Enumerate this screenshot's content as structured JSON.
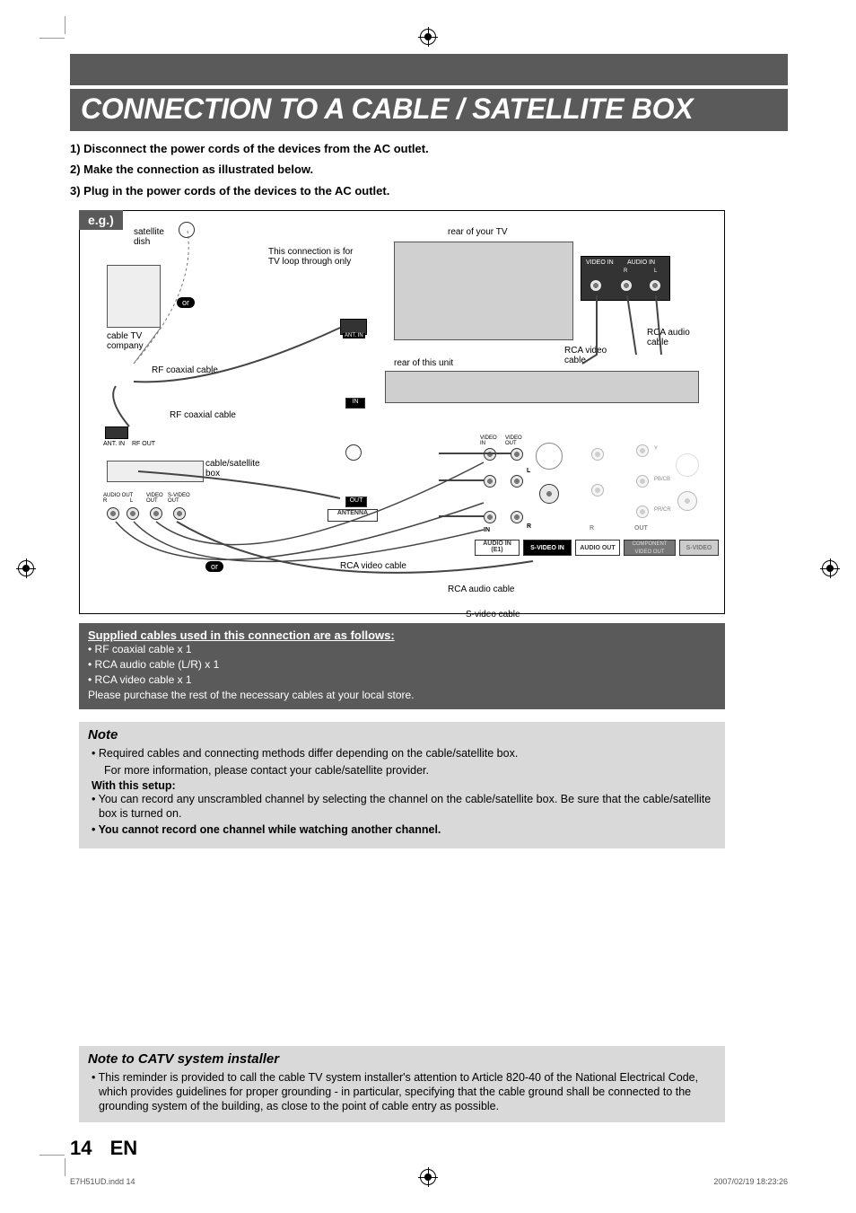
{
  "title": "CONNECTION TO A CABLE / SATELLITE BOX",
  "steps": {
    "s1": "1) Disconnect the power cords of the devices from the AC outlet.",
    "s2": "2) Make the connection as illustrated below.",
    "s3": "3) Plug in the power cords of the devices to the AC outlet."
  },
  "diagram": {
    "eg": "e.g.)",
    "satellite_dish": "satellite\ndish",
    "cable_tv_company": "cable TV\ncompany",
    "rf_coaxial_cable": "RF coaxial cable",
    "rf_coaxial_cable2": "RF coaxial cable",
    "cable_satellite_box": "cable/satellite\nbox",
    "or_upper": "or",
    "or_lower": "or",
    "loop_through": "This connection is for\nTV loop through only",
    "rear_tv": "rear of your TV",
    "rear_unit": "rear of this unit",
    "rca_video_cable": "RCA video\ncable",
    "rca_audio_cable": "RCA audio\ncable",
    "rca_video_cable2": "RCA video cable",
    "rca_audio_cable2": "RCA audio cable",
    "svideo_cable": "S-video cable",
    "ant_in": "ANT. IN",
    "ant_in_small": "ANT. IN",
    "rf_out": "RF OUT",
    "audio_out_r": "AUDIO OUT\nR",
    "audio_out_l": "L",
    "video_out_small": "VIDEO\nOUT",
    "svideo_out_small": "S-VIDEO\nOUT",
    "in_label": "IN",
    "out_label": "OUT",
    "antenna_label": "ANTENNA",
    "video_in_tv": "VIDEO IN",
    "audio_in_tv": "AUDIO IN",
    "r_label": "R",
    "l_label": "L",
    "video_in": "VIDEO\nIN",
    "video_out": "VIDEO\nOUT",
    "audio_in_e1": "AUDIO IN\n(E1)",
    "svideo_in": "S-VIDEO IN",
    "audio_out": "AUDIO OUT",
    "component_video_out": "COMPONENT\nVIDEO OUT",
    "svideo": "S-VIDEO",
    "y_label": "Y",
    "pb_label": "PB/CB",
    "pr_label": "PR/CR"
  },
  "supplied": {
    "title": "Supplied cables used in this connection are as follows:",
    "l1": "• RF coaxial cable x 1",
    "l2": "• RCA audio cable (L/R) x 1",
    "l3": "• RCA video cable x 1",
    "l4": "Please purchase the rest of the necessary cables at your local store."
  },
  "note": {
    "heading": "Note",
    "b1": "•  Required cables and connecting methods differ depending on the cable/satellite box.",
    "b1b": "For more information, please contact your cable/satellite provider.",
    "with": "With this setup:",
    "b2": "•  You can record any unscrambled channel by selecting the channel on the cable/satellite box. Be sure that the cable/satellite box is turned on.",
    "b3": "•  You cannot record one channel while watching another channel."
  },
  "catv": {
    "heading": "Note to CATV system installer",
    "b1": "•  This reminder is provided to call the cable TV system installer's attention to Article 820-40 of the National Electrical Code, which provides guidelines for proper grounding - in particular, specifying that the cable ground shall be connected to the grounding system of the building, as close to the point of cable entry as possible."
  },
  "page_number": "14",
  "page_lang": "EN",
  "footer_left": "E7H51UD.indd   14",
  "footer_right": "2007/02/19   18:23:26"
}
